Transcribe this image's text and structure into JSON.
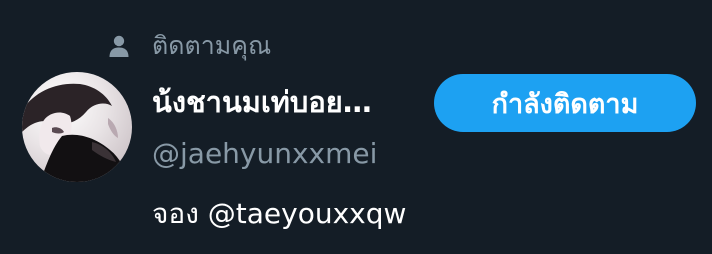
{
  "follows_you": {
    "icon": "person-icon",
    "label": "ติดตามคุณ"
  },
  "profile": {
    "avatar": "profile-avatar",
    "display_name": "น้งชานมเท่บอย…",
    "username": "@jaehyunxxmei",
    "bio": "จอง @taeyouxxqw"
  },
  "follow_button": {
    "label": "กำลังติดตาม",
    "color": "#1da1f2"
  },
  "colors": {
    "background": "#141d26",
    "secondary_text": "#8899a6",
    "primary_text": "#ffffff"
  }
}
